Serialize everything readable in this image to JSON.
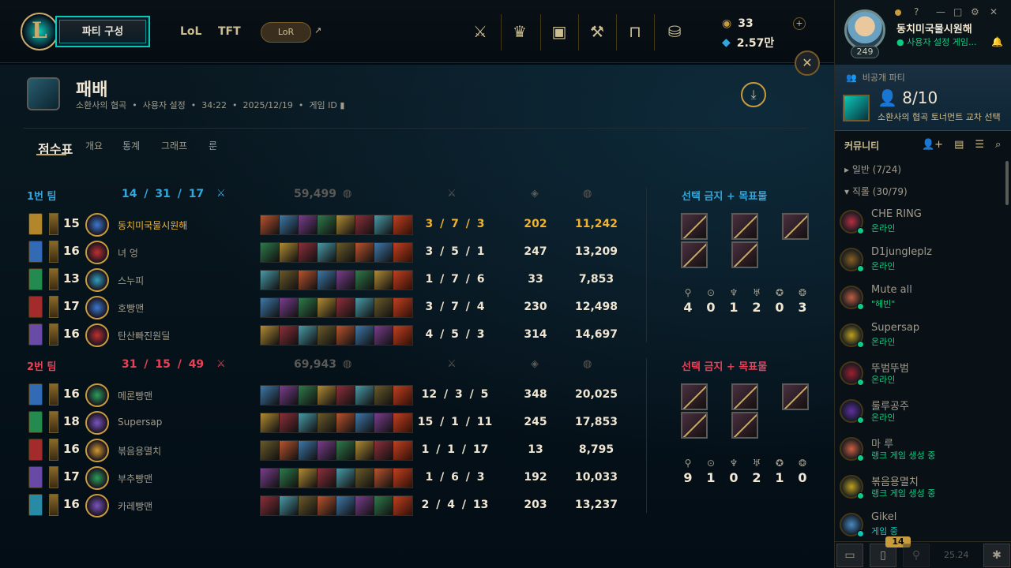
{
  "topbar": {
    "logo": "L",
    "play_label": "파티 구성",
    "nav": [
      "LoL",
      "TFT"
    ],
    "lor": "LoR",
    "ext": "↗",
    "icons": [
      "clash-icon",
      "tft-icon",
      "store-icon",
      "crafting-icon",
      "collection-icon",
      "loot-icon"
    ]
  },
  "currency": {
    "rp": "33",
    "be": "2.57만",
    "plus": "+"
  },
  "profile": {
    "name": "동치미국물시원해",
    "status": "사용자 설정 게임...",
    "level": "249"
  },
  "window": {
    "help": "?",
    "min": "—",
    "max": "□",
    "settings": "⚙",
    "close": "✕"
  },
  "header": {
    "title": "패배",
    "mode": "소환사의 협곡",
    "custom": "사용자 설정",
    "duration": "34:22",
    "date": "2025/12/19",
    "gameid": "게임 ID",
    "dl": "⤓",
    "close": "✕"
  },
  "tabs": [
    "점수표",
    "개요",
    "통계",
    "그래프",
    "룬"
  ],
  "colors": {
    "blue": "#34a6db",
    "red": "#e84057",
    "gold": "#f0b232"
  },
  "teams": [
    {
      "name": "1번 팀",
      "kda": "14 / 31 / 17",
      "gold": "59,499",
      "bans_label": "선택 금지 + 목표물",
      "color": "#34a6db",
      "objectives": [
        "4",
        "0",
        "1",
        "2",
        "0",
        "3"
      ],
      "players": [
        {
          "level": "15",
          "name": "동치미국물시원해",
          "kda": "3 / 7 / 3",
          "cs": "202",
          "gold": "11,242",
          "highlight": true
        },
        {
          "level": "16",
          "name": "녀 엉",
          "kda": "3 / 5 / 1",
          "cs": "247",
          "gold": "13,209"
        },
        {
          "level": "13",
          "name": "스누피",
          "kda": "1 / 7 / 6",
          "cs": "33",
          "gold": "7,853"
        },
        {
          "level": "17",
          "name": "호빵맨",
          "kda": "3 / 7 / 4",
          "cs": "230",
          "gold": "12,498"
        },
        {
          "level": "16",
          "name": "탄산빠진원딜",
          "kda": "4 / 5 / 3",
          "cs": "314",
          "gold": "14,697"
        }
      ]
    },
    {
      "name": "2번 팀",
      "kda": "31 / 15 / 49",
      "gold": "69,943",
      "bans_label": "선택 금지 + 목표물",
      "color": "#e84057",
      "objectives": [
        "9",
        "1",
        "0",
        "2",
        "1",
        "0"
      ],
      "players": [
        {
          "level": "16",
          "name": "메론빵맨",
          "kda": "12 / 3 / 5",
          "cs": "348",
          "gold": "20,025"
        },
        {
          "level": "18",
          "name": "Supersap",
          "kda": "15 / 1 / 11",
          "cs": "245",
          "gold": "17,853"
        },
        {
          "level": "16",
          "name": "볶음용멸치",
          "kda": "1 / 1 / 17",
          "cs": "13",
          "gold": "8,795"
        },
        {
          "level": "17",
          "name": "부추빵맨",
          "kda": "1 / 6 / 3",
          "cs": "192",
          "gold": "10,033"
        },
        {
          "level": "16",
          "name": "카레빵맨",
          "kda": "2 / 4 / 13",
          "cs": "203",
          "gold": "13,237"
        }
      ]
    }
  ],
  "party": {
    "header": "비공개 파티",
    "count": "8/10",
    "mode": "소환사의 협곡 토너먼트 교차 선택"
  },
  "community": {
    "title": "커뮤니티",
    "folders": [
      "▸  일반 (7/24)",
      "▾  직롤 (30/79)"
    ]
  },
  "friends": [
    {
      "name": "CHE RING",
      "status": "온라인",
      "color": "#0acf83"
    },
    {
      "name": "D1jungleplz",
      "status": "온라인",
      "color": "#0acf83"
    },
    {
      "name": "Mute all",
      "status": "\"헤빈\"",
      "color": "#0acf83"
    },
    {
      "name": "Supersap",
      "status": "온라인",
      "color": "#0acf83"
    },
    {
      "name": "뚜범뚜범",
      "status": "온라인",
      "color": "#0acf83"
    },
    {
      "name": "룰루공주",
      "status": "온라인",
      "color": "#0acf83"
    },
    {
      "name": "마 루",
      "status": "랭크 게임 생성 중",
      "color": "#0acf83"
    },
    {
      "name": "볶음용멸치",
      "status": "랭크 게임 생성 중",
      "color": "#0acf83"
    },
    {
      "name": "Gikel",
      "status": "게임 중",
      "color": "#0ac8b9"
    }
  ],
  "bottom": {
    "badge": "14",
    "version": "25.24"
  }
}
